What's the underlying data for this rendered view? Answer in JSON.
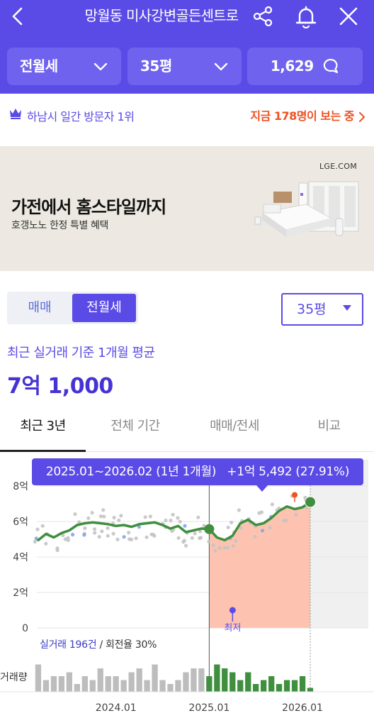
{
  "header": {
    "title": "망월동 미사강변골든센트로",
    "deal_type": "전월세",
    "size": "35평",
    "comment_count": "1,629"
  },
  "info_bar": {
    "rank_text": "하남시 일간 방문자 1위",
    "viewers_text": "지금 178명이 보는 중"
  },
  "ad": {
    "source": "LGE.COM",
    "headline": "가전에서 홈스타일까지",
    "subtext": "호갱노노 한정 특별 혜택"
  },
  "deal": {
    "tabs": [
      "매매",
      "전월세"
    ],
    "active_tab": "전월세",
    "size_select": "35평",
    "avg_label": "최근 실거래 기준 1개월 평균",
    "avg_value": "7억 1,000"
  },
  "period_tabs": [
    "최근 3년",
    "전체 기간",
    "매매/전세",
    "비교"
  ],
  "tooltip": {
    "range": "2025.01~2026.02 (1년 1개월)",
    "change": "+1억 5,492 (27.91%)"
  },
  "stats": {
    "label_prefix": "실거래 196건",
    "label_suffix": "/ 회전율 30%",
    "min_marker": "최저",
    "volume_label": "거래량"
  },
  "colors": {
    "brand": "#5b4be6",
    "line": "#3f8f3f",
    "highlight_fill": "#fdc3b0",
    "accent_orange": "#ee5222"
  },
  "icons": [
    "back-arrow-icon",
    "share-icon",
    "bell-icon",
    "close-icon",
    "chevron-down-icon",
    "comment-icon",
    "crown-icon",
    "chevron-right-icon",
    "caret-down-icon"
  ],
  "chart_data": {
    "type": "line",
    "ylabel": "",
    "y_ticks": [
      "0",
      "2억",
      "4억",
      "6억",
      "8억"
    ],
    "ylim": [
      0,
      8
    ],
    "x_ticks": [
      "2024.01",
      "2025.01",
      "2026.01"
    ],
    "series": [
      {
        "x": [
          "2023.03",
          "2023.04",
          "2023.05",
          "2023.06",
          "2023.07",
          "2023.08",
          "2023.09",
          "2023.10",
          "2023.11",
          "2023.12",
          "2024.01",
          "2024.02",
          "2024.03",
          "2024.04",
          "2024.05",
          "2024.06",
          "2024.07",
          "2024.08",
          "2024.09",
          "2024.10",
          "2024.11",
          "2024.12",
          "2025.01",
          "2025.02",
          "2025.03",
          "2025.04",
          "2025.05",
          "2025.06",
          "2025.07",
          "2025.08",
          "2025.09",
          "2025.10",
          "2025.11",
          "2025.12",
          "2026.01",
          "2026.02"
        ],
        "values": [
          4.95,
          5.3,
          5.1,
          5.35,
          5.5,
          5.8,
          5.9,
          5.95,
          5.9,
          5.85,
          5.75,
          5.8,
          5.7,
          5.85,
          5.9,
          5.95,
          5.8,
          5.6,
          5.75,
          5.4,
          5.5,
          5.6,
          5.57,
          5.1,
          4.95,
          5.2,
          5.9,
          6.1,
          5.8,
          5.9,
          6.2,
          6.6,
          6.85,
          6.7,
          6.8,
          7.1
        ]
      }
    ],
    "highlight_range": [
      "2025.01",
      "2026.02"
    ],
    "volume": {
      "categories": [
        "2023.03",
        "2023.04",
        "2023.05",
        "2023.06",
        "2023.07",
        "2023.08",
        "2023.09",
        "2023.10",
        "2023.11",
        "2023.12",
        "2024.01",
        "2024.02",
        "2024.03",
        "2024.04",
        "2024.05",
        "2024.06",
        "2024.07",
        "2024.08",
        "2024.09",
        "2024.10",
        "2024.11",
        "2024.12",
        "2025.01",
        "2025.02",
        "2025.03",
        "2025.04",
        "2025.05",
        "2025.06",
        "2025.07",
        "2025.08",
        "2025.09",
        "2025.10",
        "2025.11",
        "2025.12",
        "2026.01",
        "2026.02"
      ],
      "values": [
        7,
        3,
        4,
        4,
        5,
        2,
        4,
        3,
        6,
        4,
        4,
        3,
        5,
        6,
        3,
        7,
        3,
        2,
        3,
        5,
        6,
        6,
        4,
        7,
        6,
        5,
        3,
        5,
        2,
        3,
        4,
        2,
        3,
        3,
        4,
        1
      ]
    }
  }
}
